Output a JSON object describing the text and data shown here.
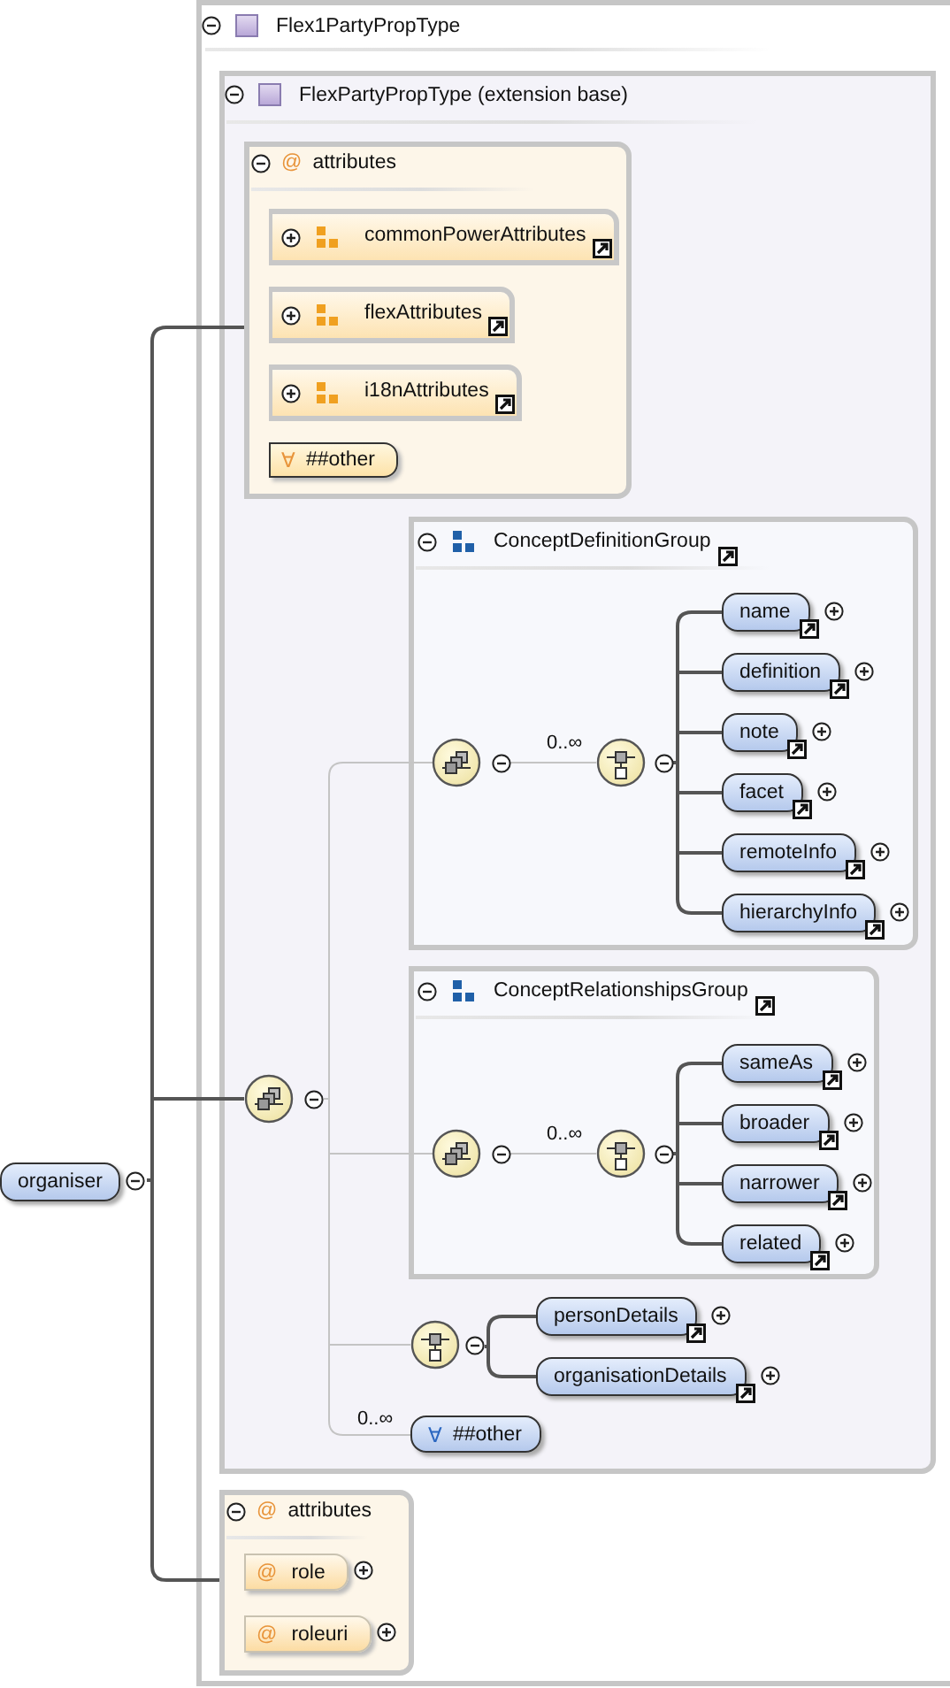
{
  "root": {
    "name": "organiser",
    "expanded": true
  },
  "type": {
    "title": "Flex1PartyPropType",
    "expanded": true
  },
  "base": {
    "title": "FlexPartyPropType (extension base)",
    "expanded": true
  },
  "base_attributes": {
    "icon": "@",
    "title": "attributes",
    "expanded": true,
    "groups": [
      {
        "name": "commonPowerAttributes",
        "expanded": false
      },
      {
        "name": "flexAttributes",
        "expanded": false
      },
      {
        "name": "i18nAttributes",
        "expanded": false
      }
    ],
    "wildcard": {
      "icon": "∀",
      "label": "##other"
    }
  },
  "content": {
    "kind": "sequence",
    "expanded": true,
    "items": [
      {
        "kind": "group",
        "title": "ConceptDefinitionGroup",
        "expanded": true,
        "compositor": {
          "kind": "sequence",
          "expanded": true
        },
        "occurs": "0..∞",
        "inner": {
          "kind": "choice",
          "expanded": true
        },
        "elements": [
          {
            "name": "name",
            "expanded": false
          },
          {
            "name": "definition",
            "expanded": false
          },
          {
            "name": "note",
            "expanded": false
          },
          {
            "name": "facet",
            "expanded": false
          },
          {
            "name": "remoteInfo",
            "expanded": false
          },
          {
            "name": "hierarchyInfo",
            "expanded": false
          }
        ]
      },
      {
        "kind": "group",
        "title": "ConceptRelationshipsGroup",
        "expanded": true,
        "compositor": {
          "kind": "sequence",
          "expanded": true
        },
        "occurs": "0..∞",
        "inner": {
          "kind": "choice",
          "expanded": true
        },
        "elements": [
          {
            "name": "sameAs",
            "expanded": false
          },
          {
            "name": "broader",
            "expanded": false
          },
          {
            "name": "narrower",
            "expanded": false
          },
          {
            "name": "related",
            "expanded": false
          }
        ]
      },
      {
        "kind": "choice",
        "expanded": true,
        "elements": [
          {
            "name": "personDetails",
            "expanded": false
          },
          {
            "name": "organisationDetails",
            "expanded": false
          }
        ]
      },
      {
        "kind": "any",
        "occurs": "0..∞",
        "icon": "∀",
        "label": "##other"
      }
    ]
  },
  "attributes": {
    "icon": "@",
    "title": "attributes",
    "expanded": true,
    "items": [
      {
        "icon": "@",
        "name": "role",
        "expanded": false
      },
      {
        "icon": "@",
        "name": "roleuri",
        "expanded": false
      }
    ]
  }
}
